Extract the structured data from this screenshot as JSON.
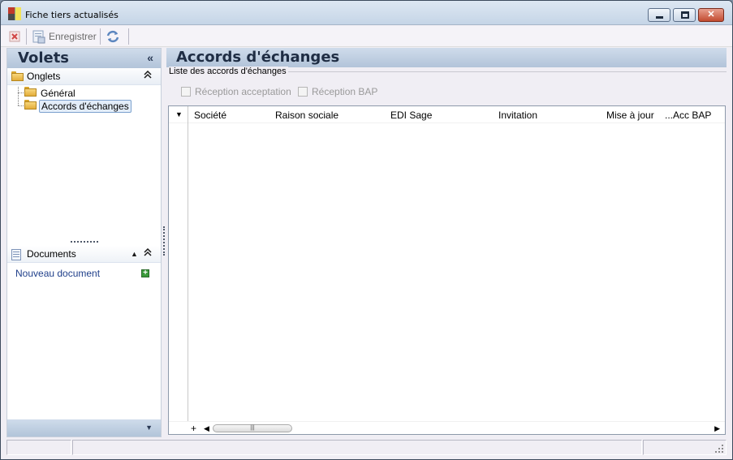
{
  "window": {
    "title": "Fiche tiers actualisés",
    "minimize_glyph": "▁",
    "maximize_glyph": "□",
    "close_glyph": "✕"
  },
  "toolbar": {
    "delete_icon": "delete-icon",
    "save_label": "Enregistrer",
    "refresh_icon": "refresh-icon"
  },
  "left_panel": {
    "title": "Volets",
    "collapse_glyph": "«",
    "onglets": {
      "title": "Onglets",
      "collapse_glyph": "⌃",
      "items": [
        {
          "label": "Général",
          "selected": false
        },
        {
          "label": "Accords d'échanges",
          "selected": true
        }
      ]
    },
    "documents": {
      "title": "Documents",
      "up_glyph": "▲",
      "collapse_glyph": "⌃",
      "new_document_label": "Nouveau document",
      "add_glyph": "+"
    },
    "footer_glyph": "▼"
  },
  "main": {
    "title": "Accords d'échanges",
    "group_label": "Liste des accords d'échanges",
    "checkboxes": [
      {
        "label": "Réception acceptation",
        "checked": false
      },
      {
        "label": "Réception BAP",
        "checked": false
      }
    ],
    "grid": {
      "dropdown_glyph": "▼",
      "columns": [
        "Société",
        "Raison sociale",
        "EDI Sage",
        "Invitation",
        "Mise à jour",
        "...Acc BAP"
      ],
      "rows": [],
      "add_glyph": "+",
      "scroll_left_glyph": "◀",
      "scroll_right_glyph": "▶",
      "thumb_glyph": "|||"
    }
  },
  "statusbar": {
    "cells": [
      "",
      "",
      ""
    ],
    "grip": "⋰"
  }
}
